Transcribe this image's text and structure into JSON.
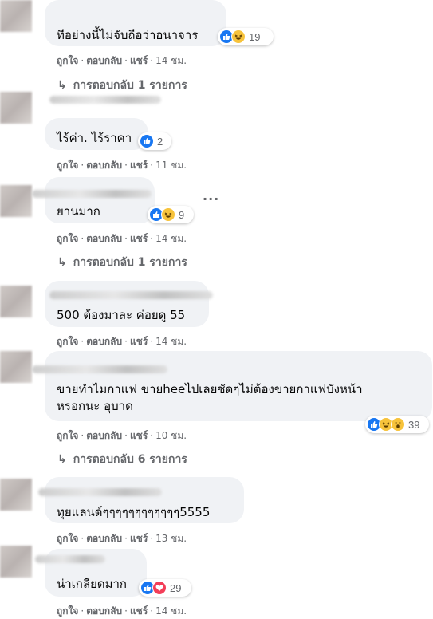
{
  "actions": {
    "like": "ถูกใจ",
    "reply": "ตอบกลับ",
    "share": "แชร์",
    "dot": "·"
  },
  "more_icon": "more-horizontal-icon",
  "reply_arrow": "↳",
  "comments": [
    {
      "text": "ทีอย่างนี้ไม่จับถือว่าอนาจาร",
      "reactions": [
        "like",
        "haha"
      ],
      "count": "19",
      "time": "14 ชม.",
      "replies": "การตอบกลับ 1 รายการ"
    },
    {
      "text": "ไร้ค่า. ไร้ราคา",
      "reactions": [
        "like"
      ],
      "count": "2",
      "time": "11 ชม."
    },
    {
      "text": "ยานมาก",
      "reactions": [
        "like",
        "haha"
      ],
      "count": "9",
      "time": "14 ชม.",
      "replies": "การตอบกลับ 1 รายการ"
    },
    {
      "text": "500 ต้องมาละ ค่อยดู 55",
      "time": "14 ชม."
    },
    {
      "text_line1": "ขายทำไมกาแฟ ขายheeไปเลยชัดๆไม่ต้องขายกาแฟบังหน้า",
      "text_line2": "หรอกนะ อุบาด",
      "reactions": [
        "like",
        "haha",
        "wow"
      ],
      "count": "39",
      "time": "10 ชม.",
      "replies": "การตอบกลับ 6 รายการ"
    },
    {
      "text": "ทุยแลนด์ๆๆๆๆๆๆๆๆๆๆๆๆ5555",
      "time": "13 ชม."
    },
    {
      "text": "น่าเกลียดมาก",
      "reactions": [
        "like",
        "love"
      ],
      "count": "29",
      "time": "14 ชม."
    }
  ],
  "colors": {
    "like": "#1877f2",
    "haha": "#f7c33b",
    "love": "#f33e58",
    "secondary_text": "#65676b",
    "bubble": "#f0f2f5"
  }
}
